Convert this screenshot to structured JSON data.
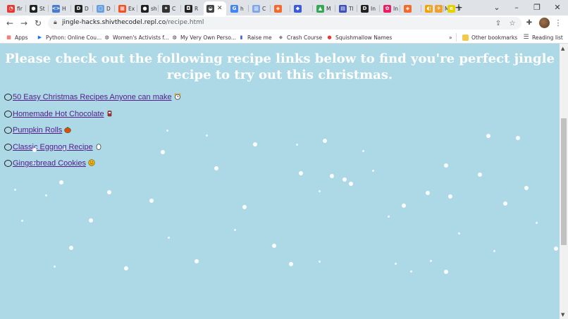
{
  "tabs": [
    {
      "label": "fir",
      "color": "#e53935",
      "glyph": "◔"
    },
    {
      "label": "St",
      "color": "#222222",
      "glyph": "●"
    },
    {
      "label": "H",
      "color": "#4a7bd0",
      "glyph": "<>"
    },
    {
      "label": "D",
      "color": "#222222",
      "glyph": "D"
    },
    {
      "label": "D",
      "color": "#6aa0e0",
      "glyph": "▢"
    },
    {
      "label": "Ex",
      "color": "#f25022",
      "glyph": "▦"
    },
    {
      "label": "sh",
      "color": "#222222",
      "glyph": "●"
    },
    {
      "label": "C",
      "color": "#333333",
      "glyph": "✦"
    },
    {
      "label": "R",
      "color": "#222222",
      "glyph": "◘"
    },
    {
      "label": "",
      "color": "#444444",
      "glyph": "◒",
      "active": true
    },
    {
      "label": "h",
      "color": "#4285f4",
      "glyph": "G"
    },
    {
      "label": "C",
      "color": "#7fa7e8",
      "glyph": "▥"
    },
    {
      "label": "",
      "color": "#f26a2c",
      "glyph": "◈"
    },
    {
      "label": "",
      "color": "#3b5bdb",
      "glyph": "◆"
    },
    {
      "label": "M",
      "color": "#34a853",
      "glyph": "▲"
    },
    {
      "label": "Tl",
      "color": "#3f51b5",
      "glyph": "▤"
    },
    {
      "label": "In",
      "color": "#222222",
      "glyph": "D"
    },
    {
      "label": "In",
      "color": "#e91e63",
      "glyph": "✿"
    },
    {
      "label": "",
      "color": "#f26a2c",
      "glyph": "◈"
    },
    {
      "label": "",
      "color": "#f4a300",
      "glyph": "◐"
    },
    {
      "label": "M",
      "color": "#f0a030",
      "glyph": "✈"
    },
    {
      "label": "5",
      "color": "#e6d200",
      "glyph": "e"
    }
  ],
  "toolbar": {
    "back_icon": "←",
    "forward_icon": "→",
    "reload_icon": "↻",
    "url_host": "jingle-hacks.shivthecodel.repl.co",
    "url_path": "/recipe.html",
    "share_icon": "⇪",
    "star_icon": "☆",
    "extensions_icon": "✚",
    "menu_icon": "⋮"
  },
  "window": {
    "dropdown_icon": "⌄",
    "minimize_icon": "–",
    "restore_icon": "❐",
    "close_icon": "✕",
    "new_tab_icon": "+"
  },
  "bookmarks": [
    {
      "label": "Apps",
      "icon": "▦",
      "color": "#e53935"
    },
    {
      "label": "Python: Online Cou...",
      "icon": "▶",
      "color": "#1a73e8"
    },
    {
      "label": "Women's Activists f...",
      "icon": "◍",
      "color": "#333333"
    },
    {
      "label": "My Very Own Perso...",
      "icon": "◍",
      "color": "#333333"
    },
    {
      "label": "Raise me",
      "icon": "▮",
      "color": "#4060d0"
    },
    {
      "label": "Crash Course",
      "icon": "◆",
      "color": "#888888"
    },
    {
      "label": "Squishmallow Names",
      "icon": "●",
      "color": "#e53935"
    }
  ],
  "bookmarks_overflow": "»",
  "other_bookmarks": "Other bookmarks",
  "reading_list": "Reading list",
  "page": {
    "heading": "Please check out the following recipe links below to find you're perfect jingle recipe to try out this christmas.",
    "recipes": [
      {
        "label": "50 Easy Christmas Recipes Anyone can make",
        "emoji": "alarm-clock"
      },
      {
        "label": "Homemade Hot Chocolate",
        "emoji": "mug"
      },
      {
        "label": "Pumpkin Rolls",
        "emoji": "pumpkin"
      },
      {
        "label": "Classic Eggnog Recipe",
        "emoji": "egg"
      },
      {
        "label": "Gingerbread Cookies",
        "emoji": "cookie"
      }
    ]
  },
  "colors": {
    "page_bg": "#add8e6",
    "link": "#551a8b",
    "heading": "#ffffff"
  }
}
